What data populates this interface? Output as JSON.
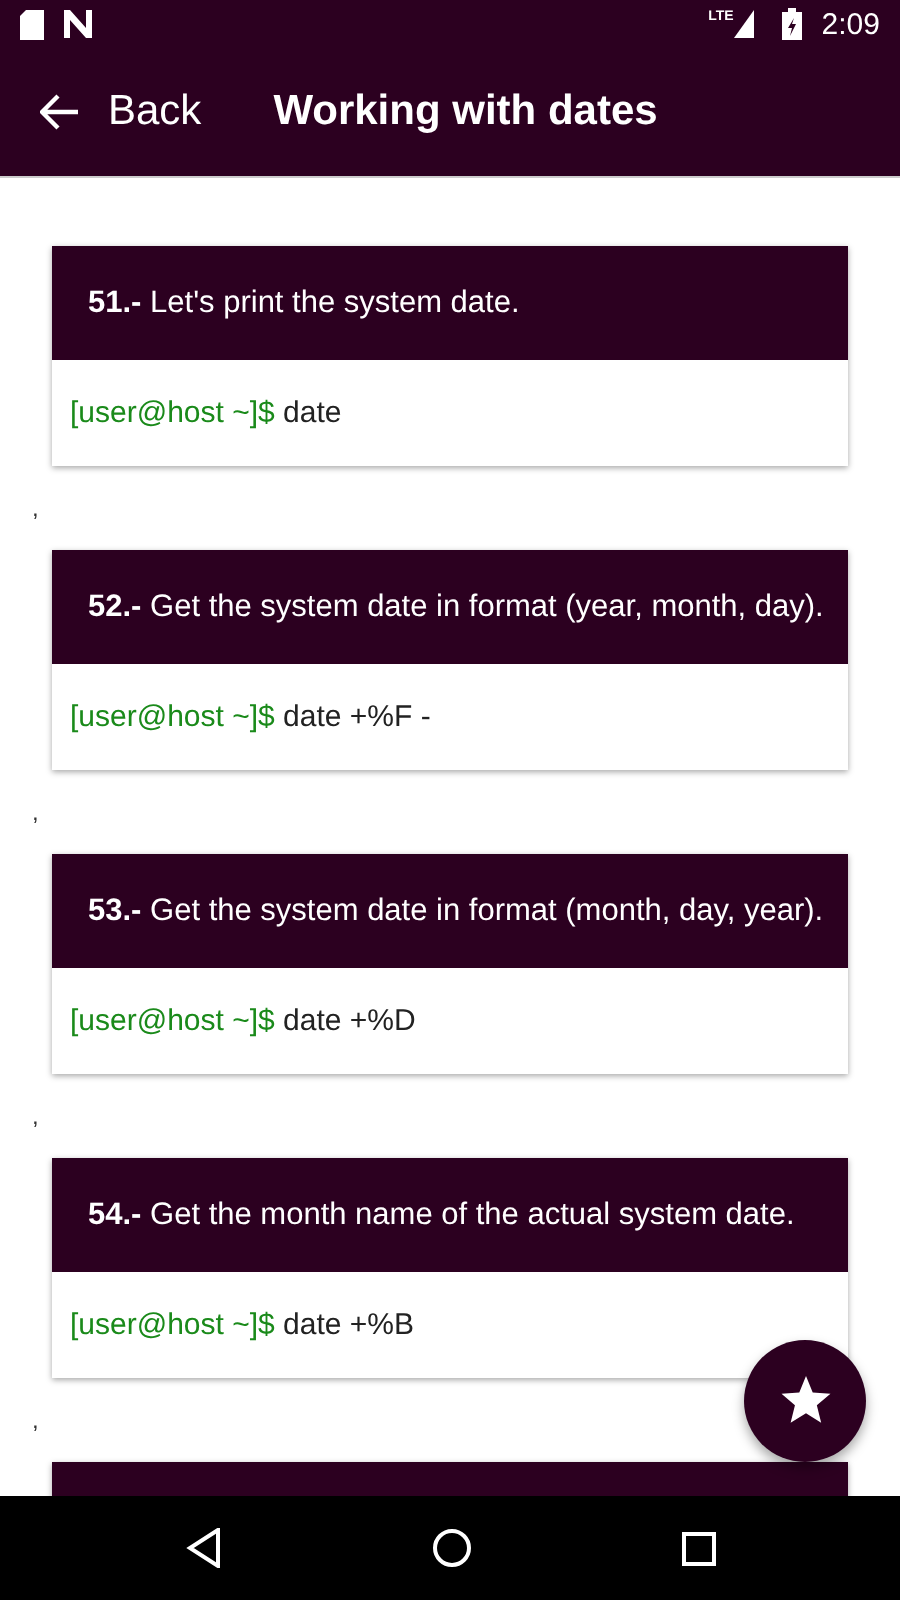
{
  "status_bar": {
    "time": "2:09",
    "network": "LTE"
  },
  "app_bar": {
    "back_label": "Back",
    "title": "Working with dates"
  },
  "exercises": [
    {
      "title": "**51.-** Let's print the system date.",
      "prompt": "[user@host ~]$",
      "command": "date",
      "separator": ","
    },
    {
      "title": "**52.-** Get the system date in format (year, month, day).",
      "prompt": "[user@host ~]$",
      "command": "date +%F -",
      "separator": ","
    },
    {
      "title": "**53.-** Get the system date in format (month, day, year).",
      "prompt": "[user@host ~]$",
      "command": "date +%D",
      "separator": ","
    },
    {
      "title": "**54.-** Get the month name of the actual system date.",
      "prompt": "[user@host ~]$",
      "command": "date +%B",
      "separator": ","
    }
  ],
  "fab": {
    "kind": "favorite"
  }
}
